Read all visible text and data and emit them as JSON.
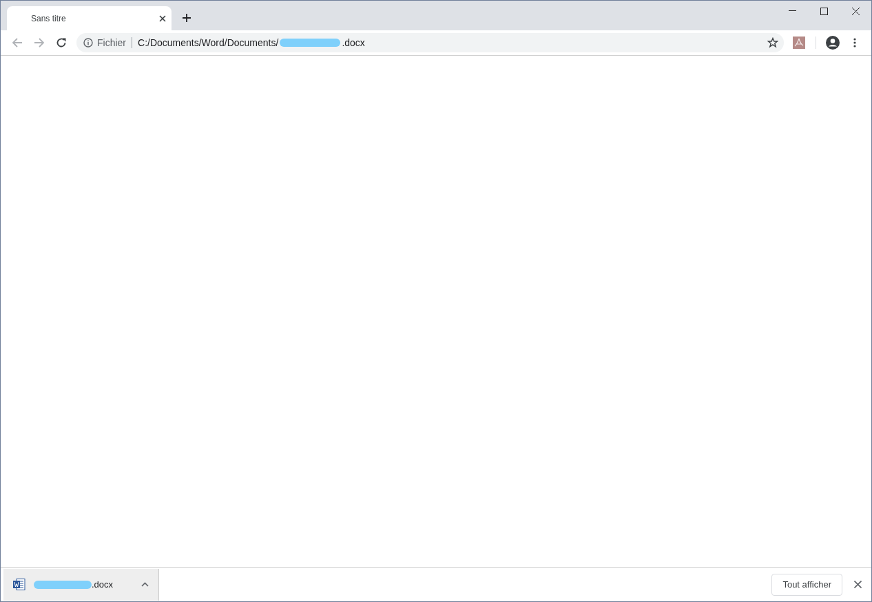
{
  "tabs": [
    {
      "title": "Sans titre",
      "selected": true
    }
  ],
  "address_bar": {
    "security_label": "Fichier",
    "url_start": "C:/Documents/Word/Documents/",
    "url_end": ".docx"
  },
  "download_bar": {
    "items": [
      {
        "filename_end": ".docx"
      }
    ],
    "show_all": "Tout afficher"
  }
}
